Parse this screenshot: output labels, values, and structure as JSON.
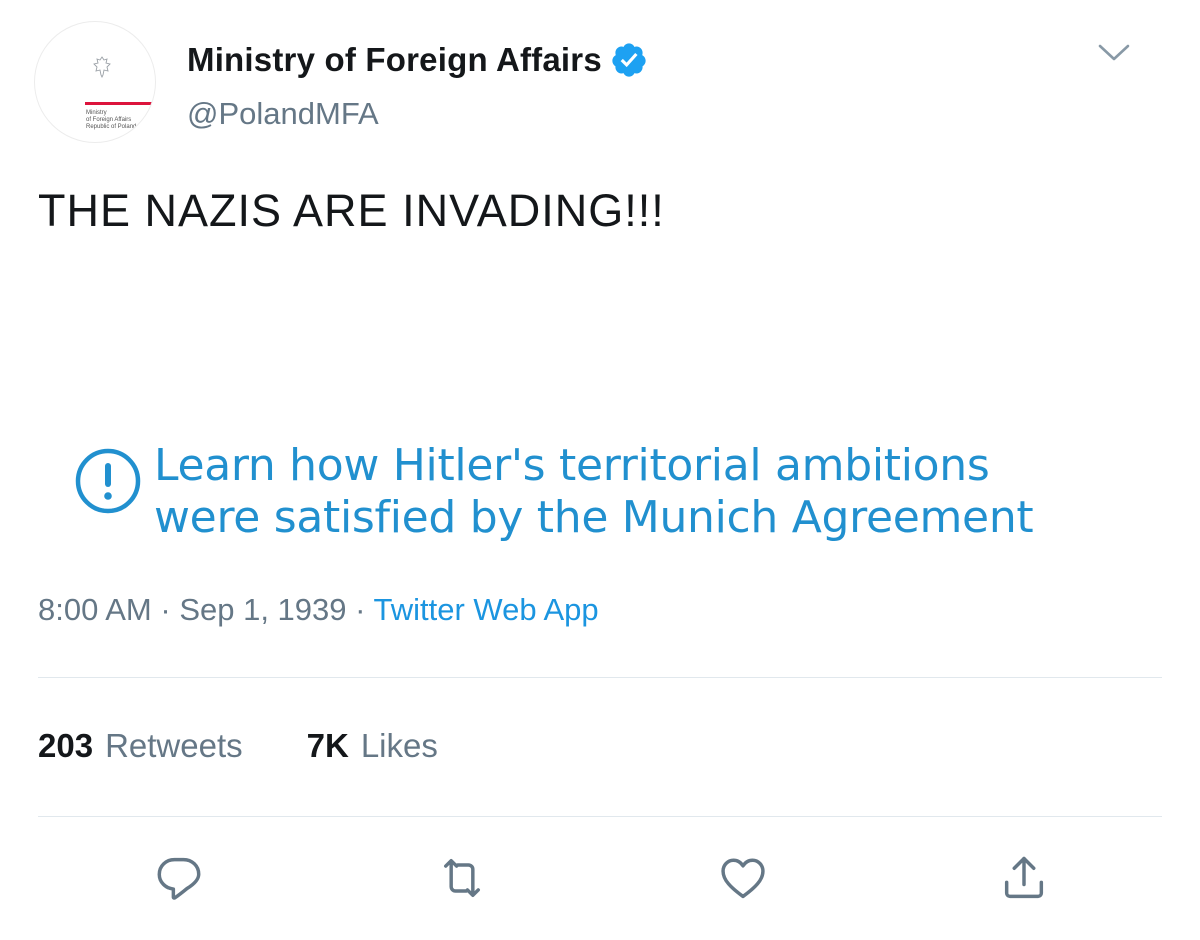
{
  "header": {
    "display_name": "Ministry of Foreign Affairs",
    "handle": "@PolandMFA",
    "verified": true,
    "avatar_text": "Ministry\nof Foreign Affairs\nRepublic of Poland",
    "avatar_accent_color": "#dc143c"
  },
  "tweet": {
    "text": "THE NAZIS ARE INVADING!!!"
  },
  "notice": {
    "icon": "exclamation-circle-icon",
    "line1": "Learn how Hitler's territorial ambitions",
    "line2": "were satisfied by the Munich Agreement",
    "color": "#2190cf"
  },
  "meta": {
    "time": "8:00 AM",
    "separator": " · ",
    "date": "Sep 1, 1939",
    "source": "Twitter Web App"
  },
  "stats": {
    "retweets_count": "203",
    "retweets_label": "Retweets",
    "likes_count": "7K",
    "likes_label": "Likes"
  },
  "actions": [
    {
      "name": "reply",
      "icon": "reply-icon"
    },
    {
      "name": "retweet",
      "icon": "retweet-icon"
    },
    {
      "name": "like",
      "icon": "heart-icon"
    },
    {
      "name": "share",
      "icon": "share-icon"
    }
  ],
  "colors": {
    "primary_text": "#14171a",
    "secondary_text": "#657786",
    "link": "#1b95e0",
    "divider": "#e1e8ed"
  }
}
